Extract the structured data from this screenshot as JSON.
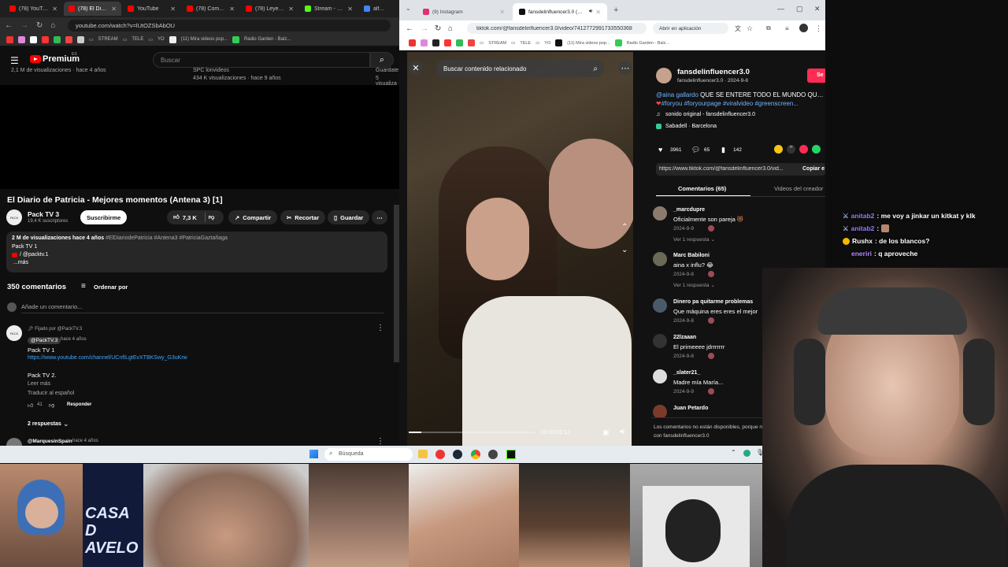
{
  "youtube_window": {
    "tabs": [
      {
        "label": "(78) YouTube",
        "active": false,
        "color": "#ff0000"
      },
      {
        "label": "(78) El Diario",
        "active": true,
        "color": "#ff0000"
      },
      {
        "label": "YouTube",
        "active": false,
        "color": "#ff0000"
      },
      {
        "label": "(78) Comando",
        "active": false,
        "color": "#ff0000"
      },
      {
        "label": "(78) Leyendas",
        "active": false,
        "color": "#ff0000"
      },
      {
        "label": "Stream - Kirk",
        "active": false,
        "color": "#53fc18"
      },
      {
        "label": "alfred neuro",
        "active": false,
        "color": "#4285f4"
      }
    ],
    "url": "youtube.com/watch?v=lUtOZSbAbOU",
    "bookmarks": [
      "STREAM",
      "TELE",
      "YO",
      "(11) Mira videos pop...",
      "Radio Garden - Balz..."
    ],
    "header": {
      "brand": "Premium",
      "brand_sup": "ES",
      "search_placeholder": "Buscar"
    },
    "related_top": {
      "left_views": "2,1 M de visualizaciones · hace 4 años",
      "mid_title": "SPC lonvideos",
      "mid_views": "434 K visualizaciones · hace 9 años",
      "right_title": "Guardate",
      "right_views": "5 visualiza"
    },
    "video": {
      "title": "El Diario de Patricia - Mejores momentos (Antena 3) [1]",
      "channel": "Pack TV 3",
      "subscribers": "19,4 K suscriptores",
      "subscribe_label": "Suscribirme",
      "likes": "7,3 K",
      "share_label": "Compartir",
      "clip_label": "Recortar",
      "save_label": "Guardar"
    },
    "description": {
      "meta": "2 M de visualizaciones  hace 4 años",
      "tags": "#ElDiariodePatricia #Antena3 #PatriciaGaztañaga",
      "line1": "Pack TV 1",
      "line2": "/ @packtv.1",
      "more": "...más"
    },
    "comments_header": {
      "count": "350 comentarios",
      "sort_label": "Ordenar por",
      "add_placeholder": "Añade un comentario..."
    },
    "pinned_comment": {
      "pinned_label": "Fijado por @PackTV.3",
      "author": "@PackTV.3",
      "time": "hace 4 años",
      "line1": "Pack TV 1",
      "link": "https://www.youtube.com/channel/UCnfILgtEvXTBKSwy_G3uKrw",
      "line2": "Pack TV 2.",
      "read_more": "Leer más",
      "translate": "Traducir al español",
      "likes": "41",
      "reply_label": "Responder",
      "replies": "2 respuestas"
    },
    "next_comment": {
      "author": "@MarquesinSpain",
      "time": "hace 4 años"
    }
  },
  "tiktok_window": {
    "tabs": [
      {
        "label": "(9) Instagram",
        "active": false
      },
      {
        "label": "fansdelinfluencer3.0 (@fans...",
        "active": true
      }
    ],
    "url": "tiktok.com/@fansdelinfluencer3.0/video/7412772991733550368",
    "open_in_app": "Abrir en aplicación",
    "bookmarks": [
      "STREAM",
      "TELE",
      "YO",
      "(11) Mira videos pop...",
      "Radio Garden - Balz..."
    ],
    "video_search_placeholder": "Buscar contenido relacionado",
    "video_time": "00:01/00:17",
    "author": {
      "username": "fansdelinfluencer3.0",
      "handle_date": "fansdelinfluencer3.0 · 2024-9-8",
      "follow_label": "Se"
    },
    "caption": {
      "mention": "@aina gallardo",
      "text": " QUE SE ENTERE TODO EL MUNDO QUE T",
      "tags": "#foryou #foryourpage #viralvideo #greenscreen..."
    },
    "sound": "sonido original - fansdelinfluencer3.0",
    "location": "Sabadell · Barcelona",
    "stats": {
      "likes": "3961",
      "comments": "65",
      "saves": "142"
    },
    "link": "https://www.tiktok.com/@fansdelinfluencer3.0/vid...",
    "copy_label": "Copiar e",
    "tabs_panel": {
      "comments": "Comentarios (65)",
      "creator_videos": "Videos del creador"
    },
    "comments": [
      {
        "name": "_marcdupre",
        "text": "Oficialmente son pareja",
        "date": "2024-9-9",
        "reply": "Ver 1 respuesta"
      },
      {
        "name": "Marc Babiloni",
        "text": "aina x influ?",
        "date": "2024-9-8",
        "reply": "Ver 1 respuesta"
      },
      {
        "name": "Dinero pa quitarme problemas",
        "text": "Que máquina eres eres el mejor",
        "date": "2024-9-8",
        "reply": ""
      },
      {
        "name": "22lzaaan",
        "text": "El primeeee jdrrrrrrr",
        "date": "2024-9-8",
        "reply": ""
      },
      {
        "name": "_slater21_",
        "text": "Madre mía María...",
        "date": "2024-9-9",
        "reply": ""
      },
      {
        "name": "Juan Petardo",
        "text": "",
        "date": "",
        "reply": ""
      }
    ],
    "footer_notice_1": "Los comentarios no están disponibles, porque no soi",
    "footer_notice_2": "con fansdelinfluencer3.0"
  },
  "taskbar": {
    "search_placeholder": "Búsqueda"
  },
  "chat": [
    {
      "user": "anitab2",
      "user_color": "#9b7bff",
      "msg": ": me voy a jinkar un kitkat y klk",
      "badge": "sword"
    },
    {
      "user": "anitab2",
      "user_color": "#9b7bff",
      "msg": ":",
      "badge": "sword"
    },
    {
      "user": "Rushx",
      "user_color": "#ffffff",
      "msg": ": de los blancos?",
      "badge": "coin"
    },
    {
      "user": "eneriri",
      "user_color": "#b388ff",
      "msg": ": q aproveche",
      "badge": ""
    }
  ],
  "strip_overlay_text": "CASA D AVELO"
}
